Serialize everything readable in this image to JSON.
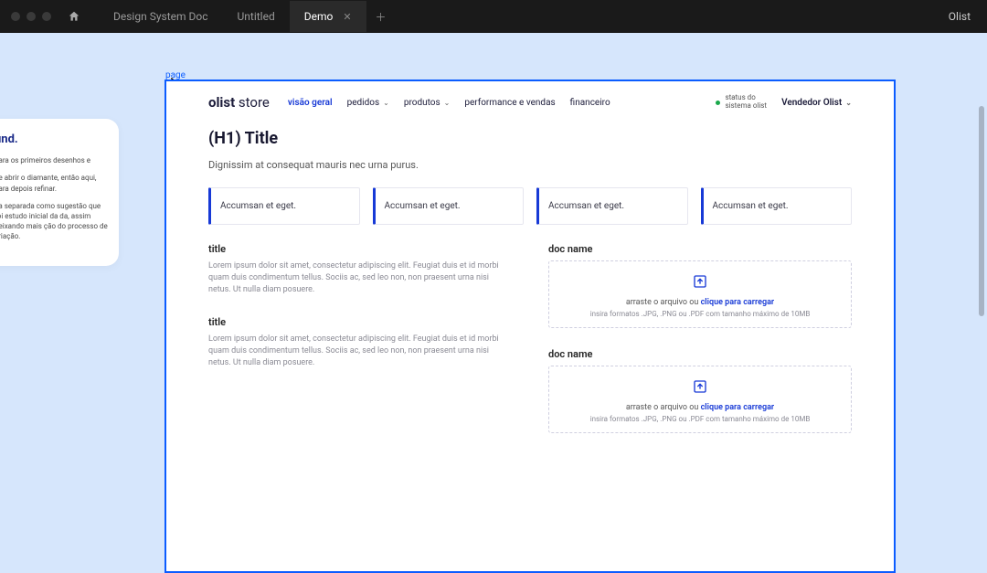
{
  "appbar": {
    "tabs": [
      "Design System Doc",
      "Untitled",
      "Demo"
    ],
    "active_tab": "Demo",
    "brand": "Olist"
  },
  "side_card": {
    "heading": "und.",
    "p1": "para os primeiros desenhos e",
    "p2": "de abrir o diamante, então aqui, para depois refinar.",
    "p3": "na separada como sugestão que foi estudo inicial da da, assim deixando mais ção do processo de criação."
  },
  "frame_label": "page",
  "page": {
    "logo_bold": "olist",
    "logo_thin": "store",
    "nav": {
      "overview": "visão geral",
      "orders": "pedidos",
      "products": "produtos",
      "performance": "performance e vendas",
      "finance": "financeiro"
    },
    "status": {
      "line1": "status do",
      "line2": "sistema olist"
    },
    "seller": "Vendedor Olist",
    "h1": "(H1) Title",
    "subtitle": "Dignissim at consequat mauris nec urna purus.",
    "card_text": "Accumsan et eget.",
    "left_blocks": [
      {
        "title": "title",
        "body": "Lorem ipsum dolor sit amet, consectetur adipiscing elit. Feugiat duis et id morbi quam duis condimentum tellus. Sociis ac, sed leo non, non praesent urna nisi netus. Ut nulla diam posuere."
      },
      {
        "title": "title",
        "body": "Lorem ipsum dolor sit amet, consectetur adipiscing elit. Feugiat duis et id morbi quam duis condimentum tellus. Sociis ac, sed leo non, non praesent urna nisi netus. Ut nulla diam posuere."
      }
    ],
    "right_blocks": [
      {
        "title": "doc name"
      },
      {
        "title": "doc name"
      }
    ],
    "upload": {
      "drag_text": "arraste o arquivo ou ",
      "link_text": "clique para carregar",
      "hint": "insira formatos .JPG, .PNG ou .PDF com tamanho máximo de 10MB"
    }
  }
}
